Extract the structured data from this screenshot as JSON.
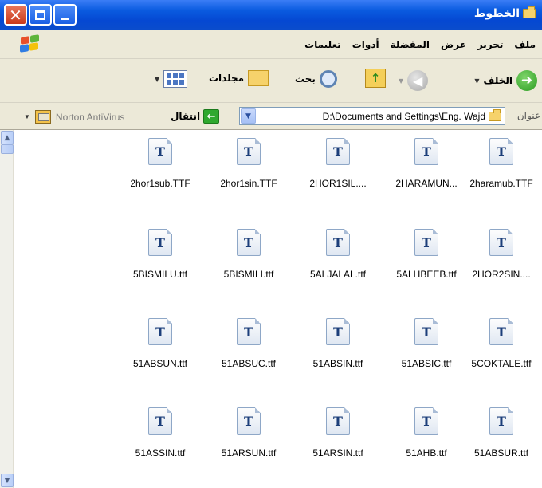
{
  "window": {
    "title": "الخطوط",
    "close_glyph": "✕"
  },
  "menu": [
    "ملف",
    "تحرير",
    "عرض",
    "المفضلة",
    "أدوات",
    "تعليمات"
  ],
  "toolbar": {
    "back_label": "الخلف",
    "search_label": "بحث",
    "folders_label": "مجلدات"
  },
  "address": {
    "label": "عنوان",
    "path": "D:\\Documents and Settings\\Eng. Wajd",
    "go_label": "انتقال",
    "norton_label": "Norton AntiVirus"
  },
  "icon_glyph": "T",
  "files": [
    [
      "2hor1sub.TTF",
      "2hor1sin.TTF",
      "2HOR1SIL....",
      "2HARAMUN...",
      "2haramub.TTF"
    ],
    [
      "5BISMILU.ttf",
      "5BISMILI.ttf",
      "5ALJALAL.ttf",
      "5ALHBEEB.ttf",
      "2HOR2SIN...."
    ],
    [
      "51ABSUN.ttf",
      "51ABSUC.ttf",
      "51ABSIN.ttf",
      "51ABSIC.ttf",
      "5COKTALE.ttf"
    ],
    [
      "51ASSIN.ttf",
      "51ARSUN.ttf",
      "51ARSIN.ttf",
      "51AHB.ttf",
      "51ABSUR.ttf"
    ]
  ]
}
